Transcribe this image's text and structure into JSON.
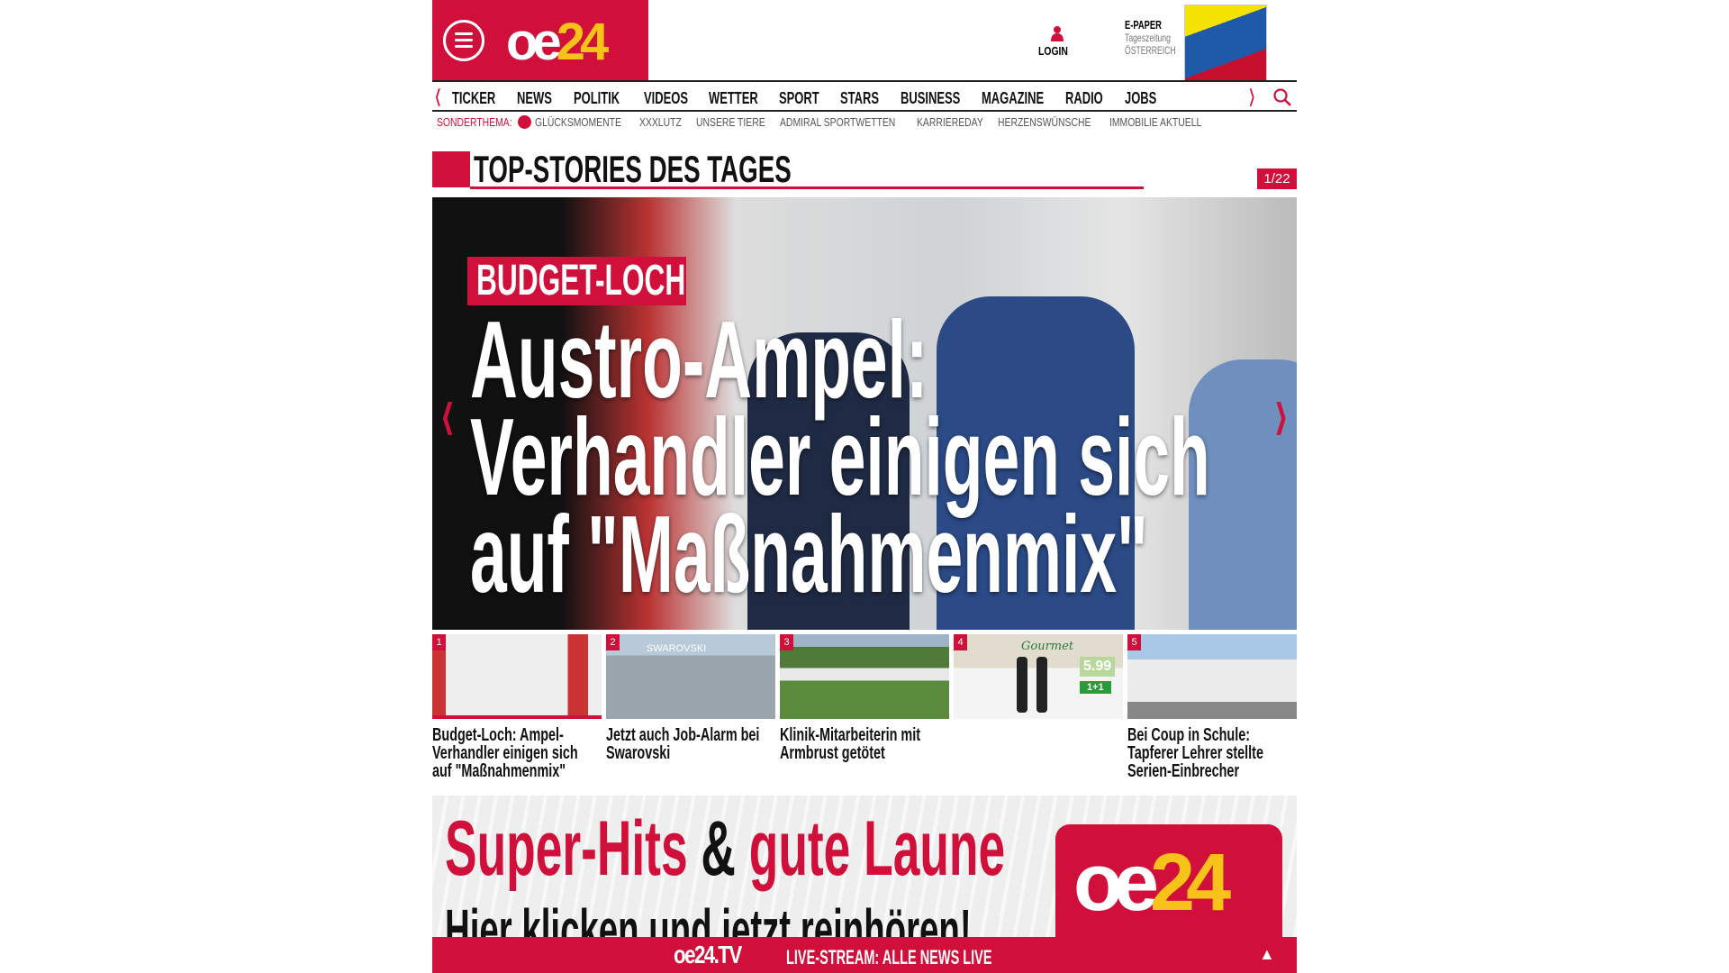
{
  "header": {
    "logo_text": "oe",
    "logo_number": "24",
    "login_label": "LOGIN",
    "epaper_title": "E-PAPER",
    "epaper_line1": "Tageszeitung",
    "epaper_line2": "ÖSTERREICH"
  },
  "nav": {
    "items": [
      "TICKER",
      "NEWS",
      "POLITIK",
      "VIDEOS",
      "WETTER",
      "SPORT",
      "STARS",
      "BUSINESS",
      "MAGAZINE",
      "RADIO",
      "JOBS"
    ]
  },
  "subnav": {
    "label": "SONDERTHEMA:",
    "items": [
      "GLÜCKSMOMENTE",
      "XXXLUTZ",
      "UNSERE TIERE",
      "ADMIRAL SPORTWETTEN",
      "KARRIEREDAY",
      "HERZENSWÜNSCHE",
      "IMMOBILIE AKTUELL"
    ]
  },
  "section": {
    "title": "TOP-STORIES DES TAGES",
    "pager": "1/22"
  },
  "hero": {
    "kicker": "BUDGET-LOCH",
    "headline_lines": [
      "Austro-Ampel:",
      "Verhandler einigen sich",
      "auf \"Maßnahmenmix\""
    ]
  },
  "thumbs": [
    {
      "num": "1",
      "caption": "Budget-Loch: Ampel-Verhandler einigen sich auf \"Maßnahmenmix\""
    },
    {
      "num": "2",
      "caption": "Jetzt auch Job-Alarm bei Swarovski",
      "image_text": "SWAROVSKI"
    },
    {
      "num": "3",
      "caption": "Klinik-Mitarbeiterin mit Armbrust getötet"
    },
    {
      "num": "4",
      "caption": "",
      "ad_brand": "Gourmet",
      "ad_price": "5.99",
      "ad_offer": "1+1"
    },
    {
      "num": "5",
      "caption": "Bei Coup in Schule: Tapferer Lehrer stellte Serien-Einbrecher"
    }
  ],
  "ad": {
    "part1": "Super-Hits",
    "amp": "&",
    "part2": "gute Laune",
    "line2": "Hier klicken und jetzt reinhören!"
  },
  "livebar": {
    "brand": "oe24.TV",
    "text": "LIVE-STREAM: ALLE NEWS LIVE"
  },
  "colors": {
    "brand": "#d0103a",
    "accent": "#f7c21a"
  }
}
